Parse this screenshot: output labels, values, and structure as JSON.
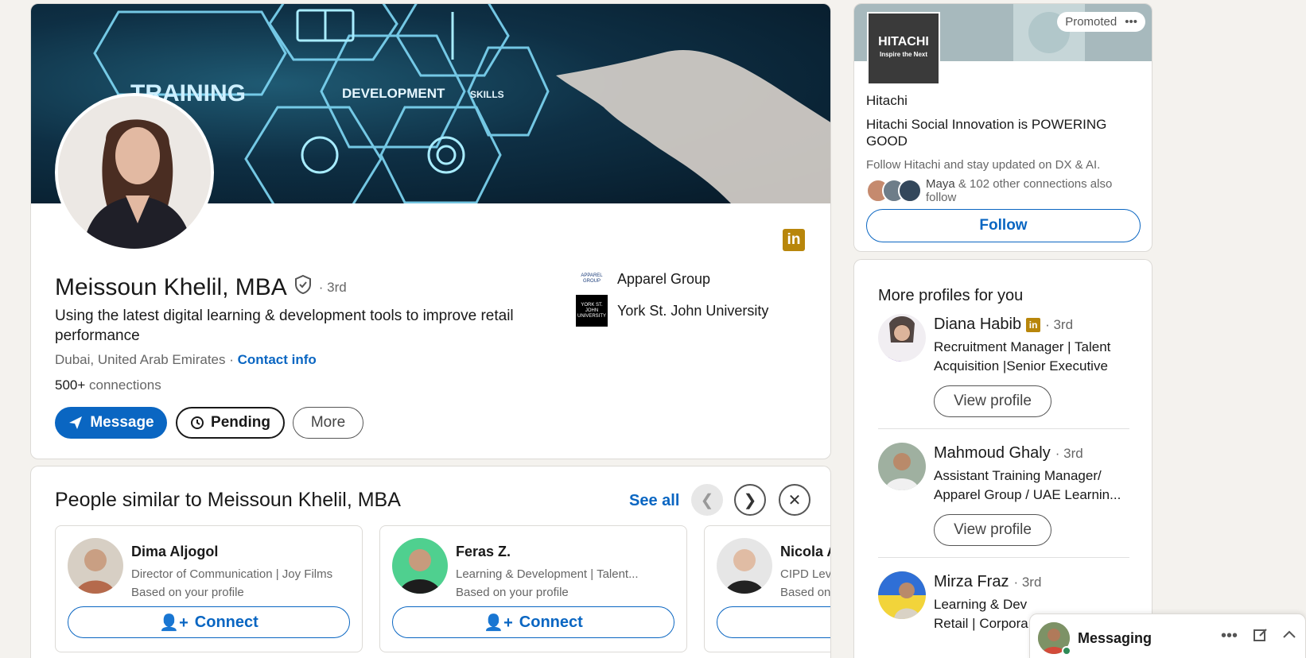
{
  "profile": {
    "name": "Meissoun Khelil, MBA",
    "degree": "· 3rd",
    "headline": "Using the latest digital learning & development tools to improve retail performance",
    "location": "Dubai, United Arab Emirates ·",
    "contact_info": "Contact info",
    "connections_count": "500+",
    "connections_label": " connections",
    "buttons": {
      "message": "Message",
      "pending": "Pending",
      "more": "More"
    },
    "banner_words": {
      "training": "TRAINING",
      "development": "DEVELOPMENT",
      "skills": "SKILLS"
    },
    "orgs": [
      {
        "name": "Apparel Group",
        "logo_text": "APPAREL GROUP"
      },
      {
        "name": "York St. John University",
        "logo_text": "YORK ST. JOHN UNIVERSITY"
      }
    ],
    "linkedin_badge": "in"
  },
  "similar": {
    "title": "People similar to Meissoun Khelil, MBA",
    "see_all": "See all",
    "people": [
      {
        "name": "Dima Aljogol",
        "title": "Director of Communication | Joy Films",
        "basis": "Based on your profile",
        "button": "Connect"
      },
      {
        "name": "Feras Z.",
        "title": "Learning & Development | Talent...",
        "basis": "Based on your profile",
        "button": "Connect"
      },
      {
        "name": "Nicola Al",
        "title": "CIPD Level",
        "basis": "Based on y",
        "button": ""
      }
    ]
  },
  "ad": {
    "promoted": "Promoted",
    "logo_main": "HITACHI",
    "logo_tag": "Inspire the Next",
    "company": "Hitachi",
    "headline": "Hitachi Social Innovation is POWERING GOOD",
    "sub": "Follow Hitachi and stay updated on DX & AI.",
    "follower_name": "Maya",
    "follower_rest": " & 102 other connections also follow",
    "follow": "Follow"
  },
  "more_profiles": {
    "title": "More profiles for you",
    "people": [
      {
        "name": "Diana Habib",
        "degree": "· 3rd",
        "title": "Recruitment Manager | Talent Acquisition |Senior Executive",
        "button": "View profile"
      },
      {
        "name": "Mahmoud Ghaly",
        "degree": "· 3rd",
        "title": "Assistant Training Manager/\n Apparel Group / UAE Learnin...",
        "button": "View profile"
      },
      {
        "name": "Mirza Fraz",
        "degree": "· 3rd",
        "title": "Learning & Dev\nRetail | Corpora",
        "button": ""
      }
    ]
  },
  "messaging": {
    "label": "Messaging"
  },
  "colors": {
    "accent": "#0a66c2",
    "page_bg": "#f4f2ee",
    "premium": "#b8860b"
  }
}
